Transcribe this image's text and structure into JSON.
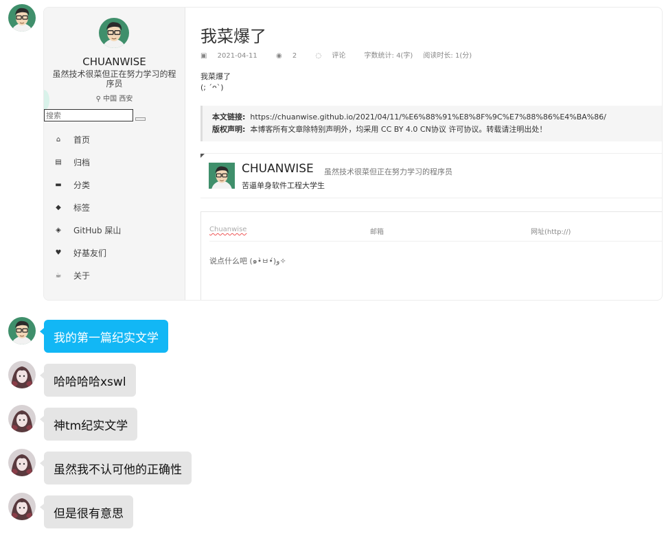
{
  "colors": {
    "accent": "#12b7f5",
    "bubble_other": "#e5e5e5"
  },
  "blog_screenshot": {
    "sidebar": {
      "name": "CHUANWISE",
      "description": "虽然技术很菜但正在努力学习的程序员",
      "location": "中国 西安",
      "search_placeholder": "搜索",
      "menu": [
        {
          "icon": "home-icon",
          "label": "首页"
        },
        {
          "icon": "archive-icon",
          "label": "归档"
        },
        {
          "icon": "folder-icon",
          "label": "分类"
        },
        {
          "icon": "tag-icon",
          "label": "标签"
        },
        {
          "icon": "cube-icon",
          "label": "GitHub 屎山"
        },
        {
          "icon": "heart-icon",
          "label": "好基友们"
        },
        {
          "icon": "coffee-icon",
          "label": "关于"
        }
      ]
    },
    "post": {
      "title": "我菜爆了",
      "date": "2021-04-11",
      "views": "2",
      "comments": "评论",
      "word_count": "字数统计: 4(字)",
      "read_time": "阅读时长: 1(分)",
      "body_line1": "我菜爆了",
      "body_line2": "(; ´ᴖ`)",
      "link_label": "本文链接:",
      "link_value": "https://chuanwise.github.io/2021/04/11/%E6%88%91%E8%8F%9C%E7%88%86%E4%BA%86/",
      "license_label": "版权声明:",
      "license_value": "本博客所有文章除特别声明外，均采用 CC BY 4.0 CN协议 许可协议。转载请注明出处！"
    },
    "author": {
      "name": "CHUANWISE",
      "motto": "虽然技术很菜但正在努力学习的程序员",
      "subtitle": "苦逼单身软件工程大学生"
    },
    "comment_form": {
      "nick": "Chuanwise",
      "email": "邮箱",
      "website": "网址(http://)",
      "placeholder": "说点什么吧 (๑•̀ㅂ•́)و✧"
    }
  },
  "chat": [
    {
      "sender": "me",
      "text": "我的第一篇纪实文学"
    },
    {
      "sender": "other",
      "text": "哈哈哈哈xswl"
    },
    {
      "sender": "other",
      "text": "神tm纪实文学"
    },
    {
      "sender": "other",
      "text": "虽然我不认可他的正确性"
    },
    {
      "sender": "other",
      "text": "但是很有意思"
    }
  ]
}
